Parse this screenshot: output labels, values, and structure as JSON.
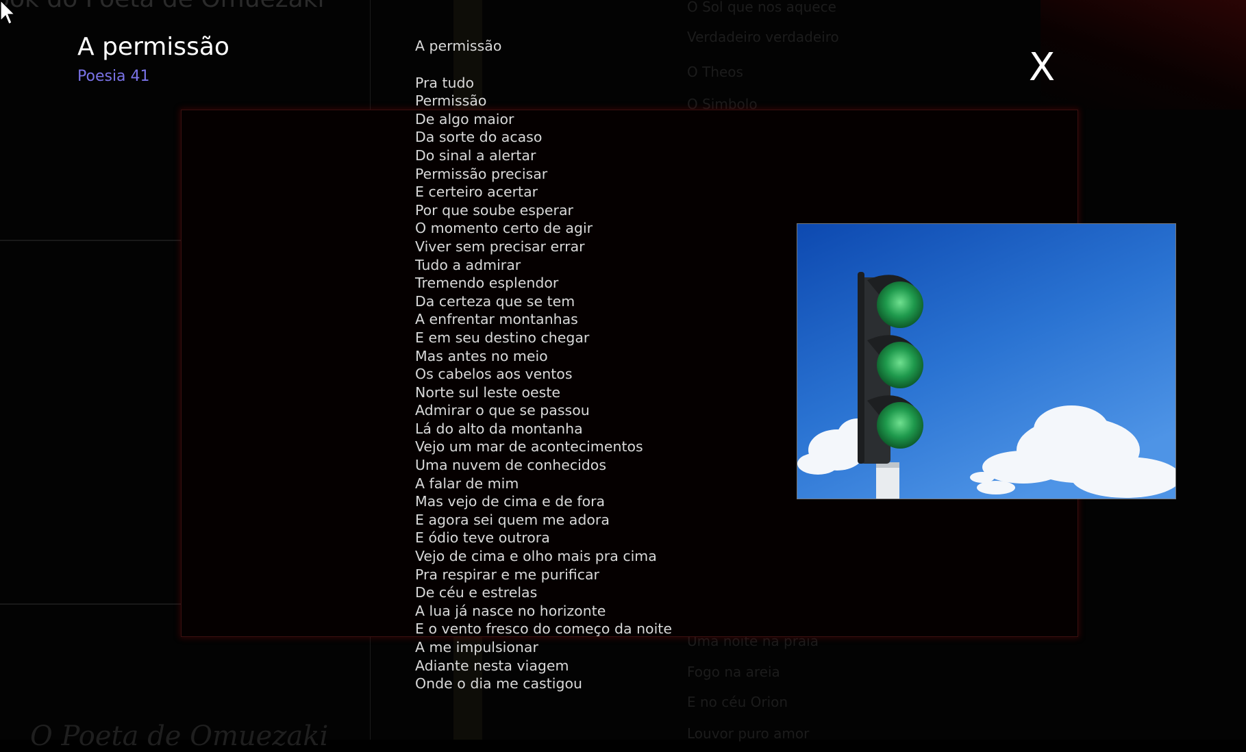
{
  "poem": {
    "heading": "A permissão",
    "number": "Poesia 41",
    "title": "A permissão",
    "lines": [
      "Pra tudo",
      "Permissão",
      "De algo maior",
      "Da sorte do acaso",
      "Do sinal a alertar",
      "Permissão precisar",
      "E certeiro acertar",
      "Por que soube esperar",
      "O momento certo de agir",
      "Viver sem precisar errar",
      "Tudo a admirar",
      "Tremendo esplendor",
      "Da certeza que se tem",
      "A enfrentar montanhas",
      "E em seu destino chegar",
      "Mas antes no meio",
      "Os cabelos aos ventos",
      "Norte sul leste oeste",
      "Admirar o que se passou",
      "Lá do alto da montanha",
      "Vejo um mar de acontecimentos",
      "Uma nuvem de conhecidos",
      "A falar de mim",
      "Mas vejo de cima e de fora",
      "E agora sei quem me adora",
      "E ódio teve outrora",
      "Vejo de cima e olho mais pra cima",
      "Pra respirar e me purificar",
      "De céu e estrelas",
      "A lua já nasce no horizonte",
      "E o vento fresco do começo da noite",
      "A me impulsionar",
      "Adiante nesta viagem",
      "Onde o dia me castigou"
    ]
  },
  "close_label": "X",
  "background": {
    "book_title": "ook do Poeta de Omuezaki",
    "author": "O Poeta de Omuezaki",
    "top_list": [
      "O Sol que nos aquece",
      "Verdadeiro  verdadeiro",
      "O Theos",
      "O Simbolo"
    ],
    "bottom_list": [
      "Uma noite na praia",
      "Fogo na areia",
      "E no céu Orion",
      "Louvor puro amor"
    ]
  },
  "image": {
    "subject": "traffic-light-green"
  },
  "colors": {
    "poem_number": "#7a73e8",
    "frame_border": "#3a1010",
    "sky": "#1f63c2"
  }
}
